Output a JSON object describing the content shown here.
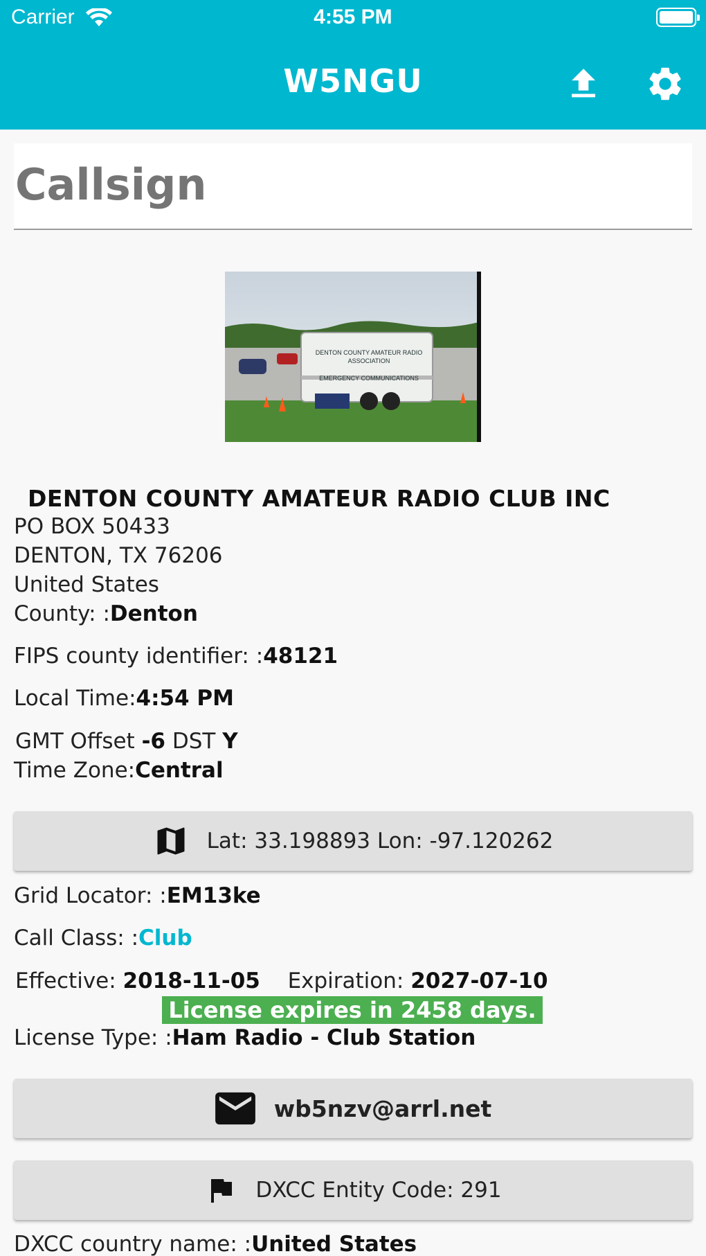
{
  "status": {
    "carrier": "Carrier",
    "time": "4:55 PM"
  },
  "appbar": {
    "title": "W5NGU",
    "upload_icon": "upload-icon",
    "settings_icon": "gear-icon"
  },
  "search": {
    "placeholder": "Callsign"
  },
  "licensee": {
    "name": "DENTON COUNTY AMATEUR RADIO CLUB INC",
    "address1": "PO BOX 50433",
    "address2": "DENTON, TX  76206",
    "country": "United States"
  },
  "details": {
    "county_label": "County: :",
    "county": "Denton",
    "fips_label": "FIPS county identifier: :",
    "fips": "48121",
    "local_time_label": "Local Time:",
    "local_time": "4:54 PM",
    "gmt_label": "GMT Offset ",
    "gmt": "-6",
    "dst_label": " DST ",
    "dst": "Y",
    "tz_label": "Time Zone:",
    "tz": "Central",
    "latlon": "Lat: 33.198893 Lon: -97.120262",
    "grid_label": "Grid Locator: :",
    "grid": "EM13ke",
    "class_label": "Call Class: :",
    "class": "Club",
    "effective_label": "Effective: ",
    "effective": "2018-11-05",
    "expiration_label": "Expiration: ",
    "expiration": "2027-07-10",
    "expires_msg": "License expires in 2458 days.",
    "license_type_label": "License Type: :",
    "license_type": "Ham Radio - Club Station",
    "email": "wb5nzv@arrl.net",
    "dxcc_code": "DXCC Entity Code: 291",
    "dxcc_country_label": "DXCC country name: :",
    "dxcc_country": "United States"
  },
  "photo": {
    "trailer_line1": "DENTON COUNTY AMATEUR RADIO",
    "trailer_line2": "ASSOCIATION",
    "trailer_line3": "EMERGENCY COMMUNICATIONS"
  },
  "colors": {
    "accent": "#00b7d0",
    "badge": "#4caf50",
    "button": "#e0e0e0"
  }
}
